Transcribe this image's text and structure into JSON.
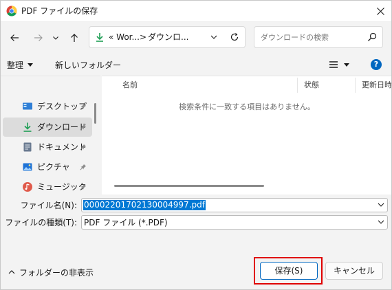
{
  "window": {
    "title": "PDF ファイルの保存",
    "icon": "chrome-icon"
  },
  "navigation": {
    "address": {
      "crumbs": [
        "« Wor...",
        "ダウンロ..."
      ],
      "separator": ">"
    },
    "search_placeholder": "ダウンロードの検索"
  },
  "toolbar": {
    "organize_label": "整理",
    "new_folder_label": "新しいフォルダー"
  },
  "sidebar": {
    "items": [
      {
        "label": "デスクトップ",
        "icon": "desktop-icon",
        "color": "#2f7fd6"
      },
      {
        "label": "ダウンロード",
        "icon": "download-icon",
        "color": "#1f9e55",
        "selected": true
      },
      {
        "label": "ドキュメント",
        "icon": "document-icon",
        "color": "#6a7a90"
      },
      {
        "label": "ピクチャ",
        "icon": "pictures-icon",
        "color": "#1f73d6"
      },
      {
        "label": "ミュージック",
        "icon": "music-icon",
        "color": "#e05a4b"
      }
    ]
  },
  "file_list": {
    "columns": [
      "名前",
      "状態",
      "更新日時"
    ],
    "empty_message": "検索条件に一致する項目はありません。"
  },
  "form": {
    "filename_label": "ファイル名(N):",
    "filename_value": "00002201702130004997.pdf",
    "filetype_label": "ファイルの種類(T):",
    "filetype_value": "PDF ファイル (*.PDF)"
  },
  "footer": {
    "hide_folders_label": "フォルダーの非表示",
    "save_label": "保存(S)",
    "cancel_label": "キャンセル"
  },
  "colors": {
    "accent": "#0067c0",
    "highlight_box": "#e00000",
    "selection": "#0078d4"
  }
}
